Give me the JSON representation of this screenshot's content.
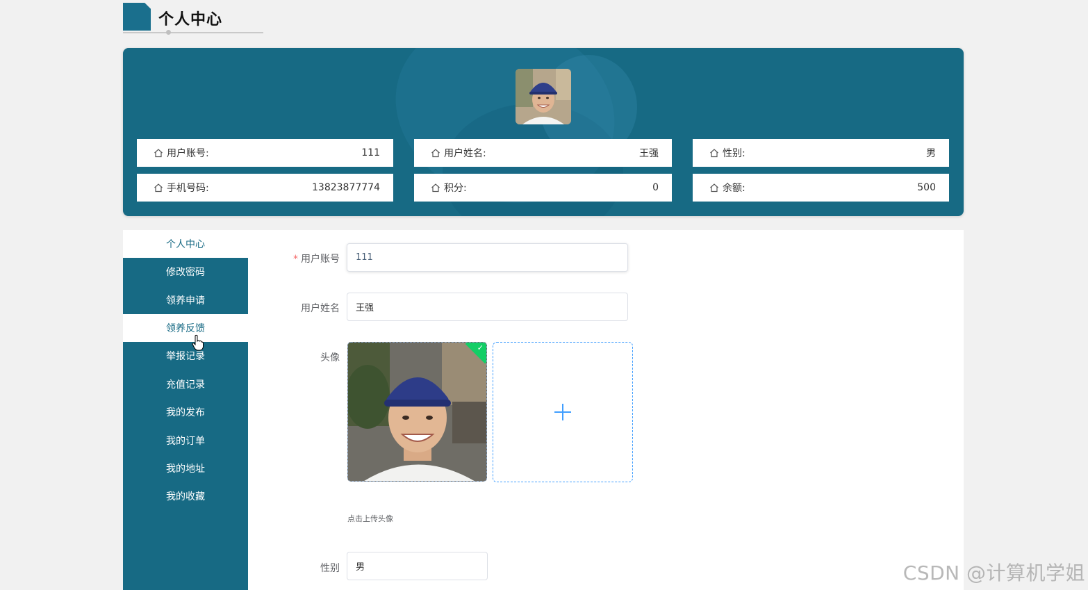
{
  "page": {
    "title": "个人中心"
  },
  "profile": {
    "fields": [
      {
        "label": "用户账号:",
        "value": "111",
        "icon": "home-icon"
      },
      {
        "label": "用户姓名:",
        "value": "王强",
        "icon": "home-icon"
      },
      {
        "label": "性别:",
        "value": "男",
        "icon": "home-icon"
      },
      {
        "label": "手机号码:",
        "value": "13823877774",
        "icon": "home-icon"
      },
      {
        "label": "积分:",
        "value": "0",
        "icon": "home-icon"
      },
      {
        "label": "余额:",
        "value": "500",
        "icon": "home-icon"
      }
    ]
  },
  "sidebar": {
    "items": [
      {
        "label": "个人中心",
        "active": true
      },
      {
        "label": "修改密码",
        "active": false
      },
      {
        "label": "领养申请",
        "active": false
      },
      {
        "label": "领养反馈",
        "active": true
      },
      {
        "label": "举报记录",
        "active": false
      },
      {
        "label": "充值记录",
        "active": false
      },
      {
        "label": "我的发布",
        "active": false
      },
      {
        "label": "我的订单",
        "active": false
      },
      {
        "label": "我的地址",
        "active": false
      },
      {
        "label": "我的收藏",
        "active": false
      }
    ]
  },
  "form": {
    "account_label": "用户账号",
    "account_required_mark": "*",
    "account_value": "111",
    "name_label": "用户姓名",
    "name_value": "王强",
    "avatar_label": "头像",
    "avatar_tip": "点击上传头像",
    "gender_label": "性别",
    "gender_value": "男"
  },
  "watermark": "CSDN @计算机学姐",
  "colors": {
    "primary": "#176a84",
    "success": "#13ce66",
    "upload_border": "#409eff",
    "required": "#f56c6c"
  }
}
